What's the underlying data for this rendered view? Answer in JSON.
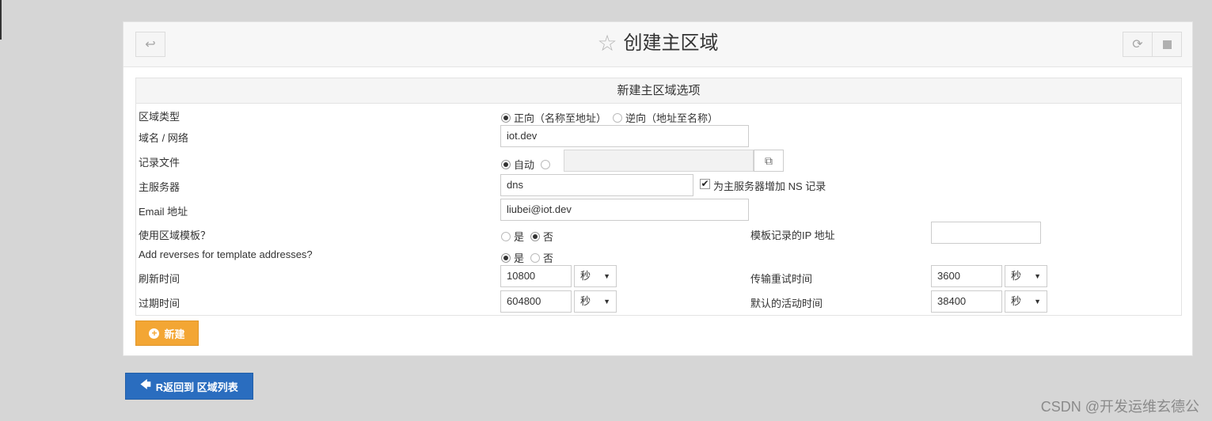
{
  "header": {
    "title": "创建主区域",
    "back_icon": "↩",
    "refresh_icon": "⟳"
  },
  "form": {
    "section_title": "新建主区域选项",
    "zone_type": {
      "label": "区域类型",
      "options": [
        "正向（名称至地址）",
        "逆向（地址至名称）"
      ],
      "selected": "正向（名称至地址）"
    },
    "domain": {
      "label": "域名 / 网络",
      "value": "iot.dev"
    },
    "record_file": {
      "label": "记录文件",
      "auto_label": "自动",
      "value": ""
    },
    "master_server": {
      "label": "主服务器",
      "value": "dns",
      "checkbox_label": "为主服务器增加 NS 记录",
      "checked": true
    },
    "email": {
      "label": "Email 地址",
      "value": "liubei@iot.dev"
    },
    "use_template": {
      "label": "使用区域模板？",
      "yes": "是",
      "no": "否",
      "selected": "否"
    },
    "template_ip": {
      "label": "模板记录的IP 地址",
      "value": ""
    },
    "add_reverses": {
      "label": "Add reverses for template addresses?",
      "yes": "是",
      "no": "否",
      "selected": "是"
    },
    "refresh_time": {
      "label": "刷新时间",
      "value": "10800",
      "unit": "秒"
    },
    "transfer_retry": {
      "label": "传输重试时间",
      "value": "3600",
      "unit": "秒"
    },
    "expire_time": {
      "label": "过期时间",
      "value": "604800",
      "unit": "秒"
    },
    "default_ttl": {
      "label": "默认的活动时间",
      "value": "38400",
      "unit": "秒"
    },
    "create_button": "新建"
  },
  "return_button": "R返回到 区域列表",
  "watermark": "CSDN @开发运维玄德公",
  "colors": {
    "create_button": "#f3a634",
    "return_button": "#2a6dbf"
  }
}
